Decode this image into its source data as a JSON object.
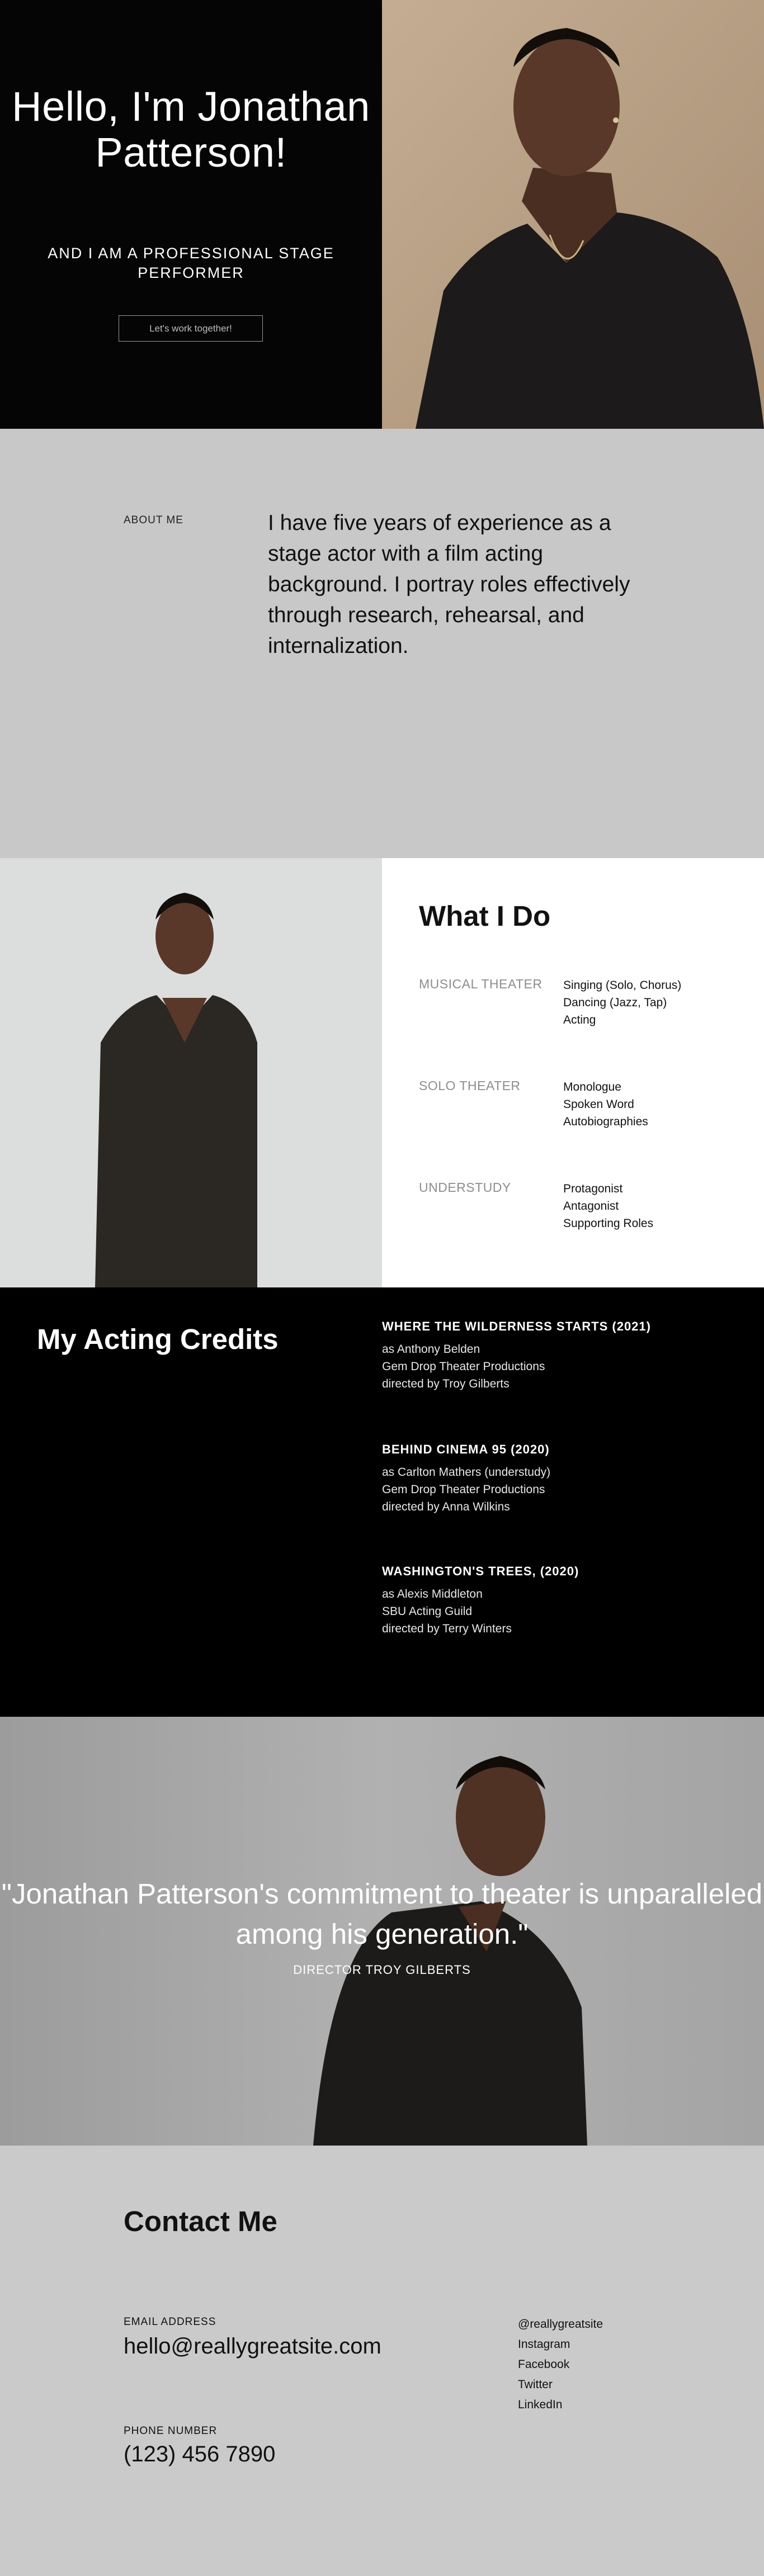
{
  "hero": {
    "title": "Hello, I'm Jonathan Patterson!",
    "subtitle": "AND I AM A PROFESSIONAL STAGE PERFORMER",
    "cta_label": "Let's work together!"
  },
  "about": {
    "label": "ABOUT ME",
    "text": "I have five years of experience as a stage actor with a film acting background. I portray roles effectively through research, rehearsal, and internalization."
  },
  "what_i_do": {
    "title": "What I Do",
    "rows": [
      {
        "category": "MUSICAL THEATER",
        "items": [
          "Singing (Solo, Chorus)",
          "Dancing (Jazz, Tap)",
          "Acting"
        ]
      },
      {
        "category": "SOLO THEATER",
        "items": [
          "Monologue",
          "Spoken Word",
          "Autobiographies"
        ]
      },
      {
        "category": "UNDERSTUDY",
        "items": [
          "Protagonist",
          "Antagonist",
          "Supporting Roles"
        ]
      }
    ]
  },
  "credits": {
    "title": "My Acting Credits",
    "entries": [
      {
        "heading": "WHERE THE WILDERNESS STARTS (2021)",
        "lines": [
          "as Anthony Belden",
          "Gem Drop Theater Productions",
          "directed by Troy Gilberts"
        ]
      },
      {
        "heading": "BEHIND CINEMA 95 (2020)",
        "lines": [
          "as Carlton Mathers (understudy)",
          "Gem Drop Theater Productions",
          "directed by Anna Wilkins"
        ]
      },
      {
        "heading": "WASHINGTON'S TREES, (2020)",
        "lines": [
          "as Alexis Middleton",
          "SBU Acting Guild",
          "directed by Terry Winters"
        ]
      }
    ]
  },
  "quote": {
    "text": "\"Jonathan Patterson's commitment to theater is unparalleled among his generation.\"",
    "attribution": "DIRECTOR TROY GILBERTS"
  },
  "contact": {
    "title": "Contact Me",
    "email_label": "EMAIL ADDRESS",
    "email": "hello@reallygreatsite.com",
    "phone_label": "PHONE NUMBER",
    "phone": "(123) 456 7890",
    "socials": [
      "@reallygreatsite",
      "Instagram",
      "Facebook",
      "Twitter",
      "LinkedIn"
    ]
  }
}
